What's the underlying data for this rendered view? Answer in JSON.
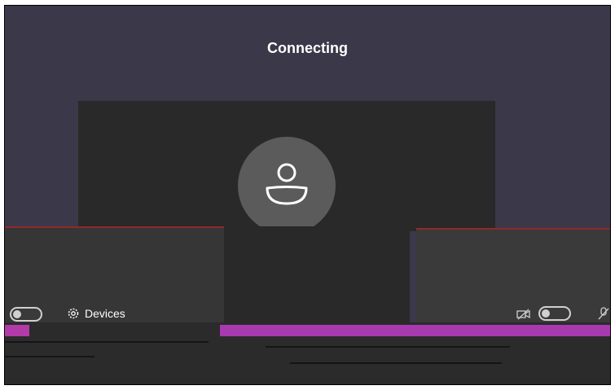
{
  "header": {
    "title": "Connecting"
  },
  "controls": {
    "devices_label": "Devices",
    "devices_icon": "gear-icon",
    "video_toggle_on": false,
    "mic_toggle_on": false
  },
  "avatar": {
    "icon": "person-icon"
  },
  "colors": {
    "background": "#3a3849",
    "preview": "#292929",
    "avatar": "#5b5b5b",
    "artifact_magenta": "#a83ab0"
  }
}
